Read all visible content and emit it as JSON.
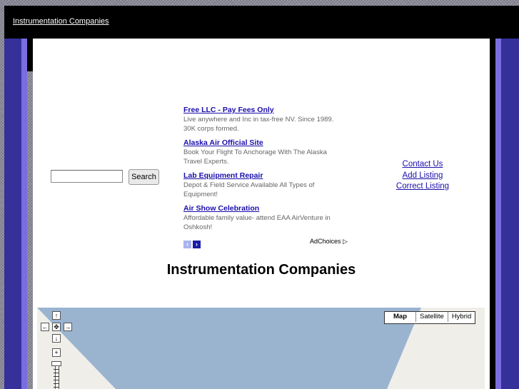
{
  "header": {
    "link_text": " Instrumentation Companies"
  },
  "search": {
    "input_value": "",
    "button_label": "Search"
  },
  "ads": {
    "items": [
      {
        "title": "Free LLC - Pay Fees Only",
        "desc": "Live anywhere and Inc in tax-free NV. Since 1989. 30K corps formed."
      },
      {
        "title": "Alaska Air Official Site",
        "desc": "Book Your Flight To Anchorage With The Alaska Travel Experts."
      },
      {
        "title": "Lab Equipment Repair",
        "desc": "Depot & Field Service Available All Types of Equipment!"
      },
      {
        "title": "Air Show Celebration",
        "desc": "Affordable family value- attend EAA AirVenture in Oshkosh!"
      }
    ],
    "prev_glyph": "‹",
    "next_glyph": "›",
    "adchoices_label": "AdChoices",
    "adchoices_icon": "▷"
  },
  "links": {
    "contact": "Contact Us ",
    "add": "Add Listing",
    "correct": "Correct Listing"
  },
  "page_title": "Instrumentation Companies",
  "map": {
    "types": [
      "Map",
      "Satellite",
      "Hybrid"
    ],
    "selected_type": "Map",
    "controls": {
      "up": "↑",
      "left": "←",
      "center": "✥",
      "right": "→",
      "down": "↓",
      "zoom_in": "+"
    },
    "water_color": "#9ab4d0",
    "land_color": "#f0eee8"
  },
  "colors": {
    "header_bg": "#000000",
    "side_dark": "#35309a",
    "side_light": "#7a6de0",
    "link": "#1a0dab"
  }
}
